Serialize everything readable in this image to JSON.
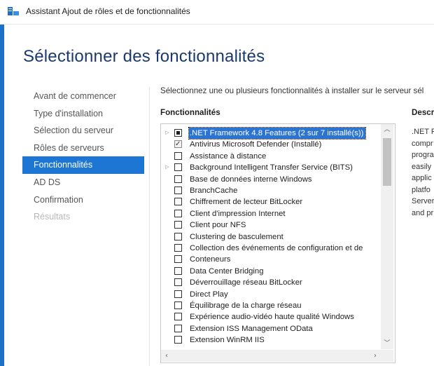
{
  "window": {
    "title": "Assistant Ajout de rôles et de fonctionnalités",
    "icon": "server-manager-icon"
  },
  "page": {
    "title": "Sélectionner des fonctionnalités",
    "intro": "Sélectionnez une ou plusieurs fonctionnalités à installer sur le serveur sél"
  },
  "nav": {
    "items": [
      {
        "label": "Avant de commencer",
        "state": "normal"
      },
      {
        "label": "Type d'installation",
        "state": "normal"
      },
      {
        "label": "Sélection du serveur",
        "state": "normal"
      },
      {
        "label": "Rôles de serveurs",
        "state": "normal"
      },
      {
        "label": "Fonctionnalités",
        "state": "active"
      },
      {
        "label": "AD DS",
        "state": "normal"
      },
      {
        "label": "Confirmation",
        "state": "normal"
      },
      {
        "label": "Résultats",
        "state": "disabled"
      }
    ]
  },
  "features": {
    "header": "Fonctionnalités",
    "items": [
      {
        "label": ".NET Framework 4.8 Features (2 sur 7 installé(s))",
        "check": "partial",
        "expandable": true,
        "selected": true
      },
      {
        "label": "Antivirus Microsoft Defender (Installé)",
        "check": "checked",
        "expandable": false,
        "selected": false
      },
      {
        "label": "Assistance à distance",
        "check": "none",
        "expandable": false,
        "selected": false
      },
      {
        "label": "Background Intelligent Transfer Service (BITS)",
        "check": "none",
        "expandable": true,
        "selected": false
      },
      {
        "label": "Base de données interne Windows",
        "check": "none",
        "expandable": false,
        "selected": false
      },
      {
        "label": "BranchCache",
        "check": "none",
        "expandable": false,
        "selected": false
      },
      {
        "label": "Chiffrement de lecteur BitLocker",
        "check": "none",
        "expandable": false,
        "selected": false
      },
      {
        "label": "Client d'impression Internet",
        "check": "none",
        "expandable": false,
        "selected": false
      },
      {
        "label": "Client pour NFS",
        "check": "none",
        "expandable": false,
        "selected": false
      },
      {
        "label": "Clustering de basculement",
        "check": "none",
        "expandable": false,
        "selected": false
      },
      {
        "label": "Collection des événements de configuration et de",
        "check": "none",
        "expandable": false,
        "selected": false
      },
      {
        "label": "Conteneurs",
        "check": "none",
        "expandable": false,
        "selected": false
      },
      {
        "label": "Data Center Bridging",
        "check": "none",
        "expandable": false,
        "selected": false
      },
      {
        "label": "Déverrouillage réseau BitLocker",
        "check": "none",
        "expandable": false,
        "selected": false
      },
      {
        "label": "Direct Play",
        "check": "none",
        "expandable": false,
        "selected": false
      },
      {
        "label": "Équilibrage de la charge réseau",
        "check": "none",
        "expandable": false,
        "selected": false
      },
      {
        "label": "Expérience audio-vidéo haute qualité Windows",
        "check": "none",
        "expandable": false,
        "selected": false
      },
      {
        "label": "Extension ISS Management OData",
        "check": "none",
        "expandable": false,
        "selected": false
      },
      {
        "label": "Extension WinRM IIS",
        "check": "none",
        "expandable": false,
        "selected": false
      }
    ]
  },
  "description": {
    "header": "Descri",
    "lines": [
      ".NET F",
      "compr",
      "progra",
      "easily",
      "applic",
      "platfo",
      "Server",
      "and pr"
    ]
  },
  "icons": {
    "expand": "expand-arrow-icon",
    "scroll_up": "chevron-up-icon",
    "scroll_down": "chevron-down-icon",
    "scroll_left": "chevron-left-icon",
    "scroll_right": "chevron-right-icon"
  },
  "colors": {
    "accent": "#1d76d3",
    "title": "#1a3a6e",
    "selection": "#2b74d2"
  }
}
